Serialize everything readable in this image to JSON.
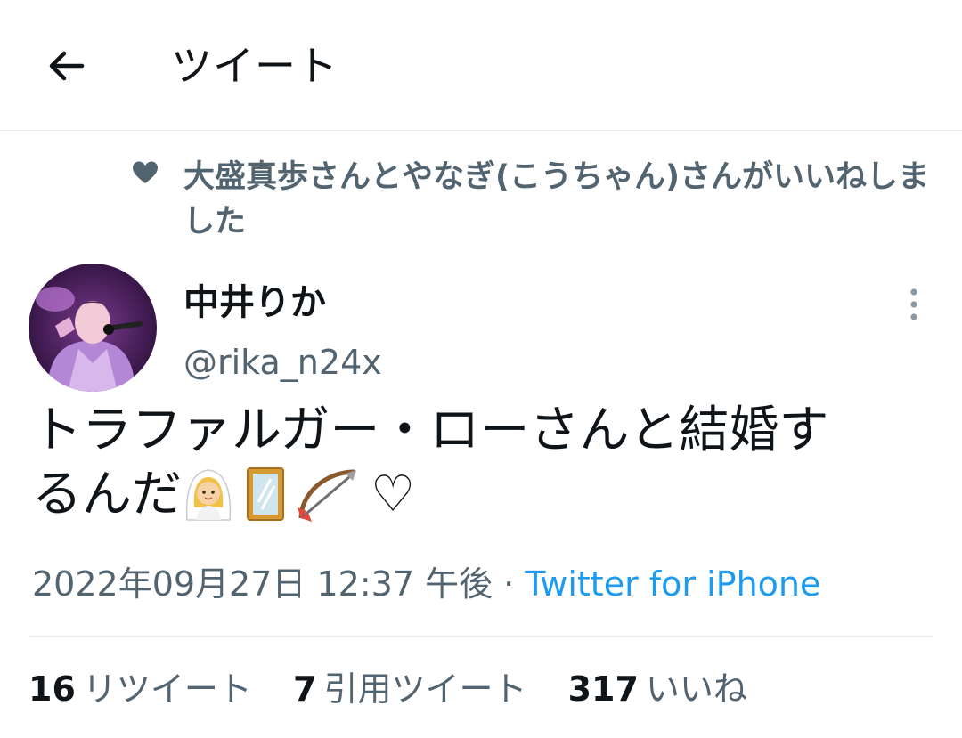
{
  "header": {
    "title": "ツイート",
    "back_icon": "arrow-left-icon"
  },
  "social_context": {
    "icon": "heart-icon",
    "text": "大盛真歩さんとやなぎ(こうちゃん)さんがいいねしました"
  },
  "tweet": {
    "author": {
      "name": "中井りか",
      "handle": "@rika_n24x"
    },
    "text_line1": "トラファルガー・ローさんと結婚す",
    "text_line2": "るんだ",
    "emojis": [
      "bride-with-veil-emoji",
      "mirror-emoji",
      "bow-and-arrow-emoji"
    ],
    "text_suffix": "♡",
    "timestamp": "2022年09月27日 12:37 午後",
    "separator": " · ",
    "source": "Twitter for iPhone"
  },
  "stats": {
    "retweets": {
      "count": "16",
      "label": "リツイート"
    },
    "quotes": {
      "count": "7",
      "label": "引用ツイート"
    },
    "likes": {
      "count": "317",
      "label": "いいね"
    }
  },
  "colors": {
    "text": "#0f1419",
    "secondary": "#536471",
    "link": "#1d9bf0",
    "border": "#e6ecf0"
  }
}
